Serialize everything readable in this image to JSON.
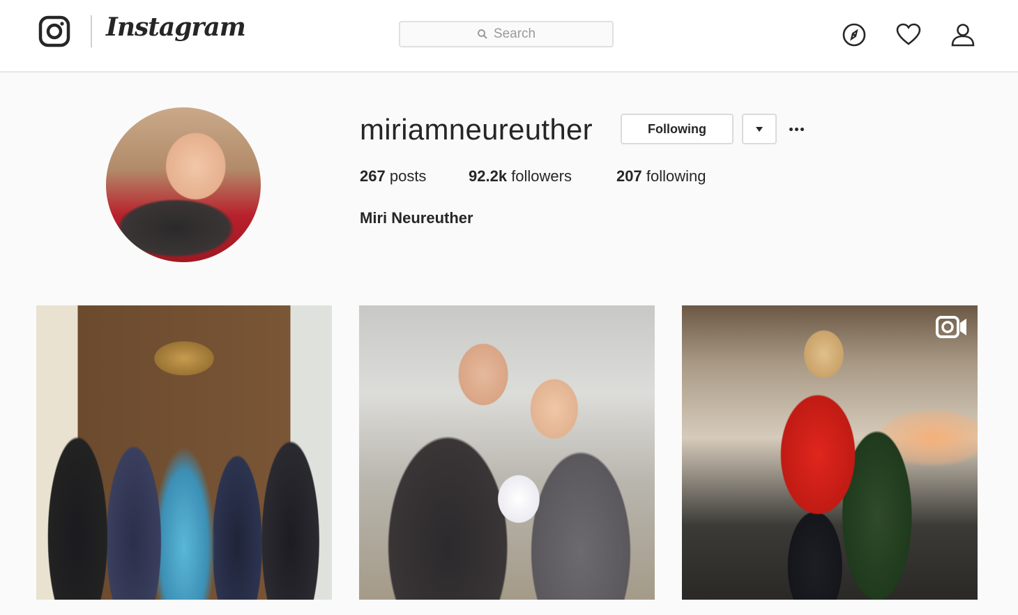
{
  "header": {
    "brand": "Instagram",
    "search_placeholder": "Search",
    "nav_icons": [
      "compass-icon",
      "heart-icon",
      "user-icon"
    ]
  },
  "profile": {
    "username": "miriamneureuther",
    "follow_button": "Following",
    "stats": {
      "posts_count": "267",
      "posts_label": "posts",
      "followers_count": "92.2k",
      "followers_label": "followers",
      "following_count": "207",
      "following_label": "following"
    },
    "full_name": "Miri Neureuther"
  },
  "posts": [
    {
      "type": "image"
    },
    {
      "type": "image"
    },
    {
      "type": "video",
      "icon": "video-camera-icon"
    }
  ],
  "colors": {
    "background": "#fafafa",
    "text": "#262626",
    "border": "#dbdbdb"
  }
}
